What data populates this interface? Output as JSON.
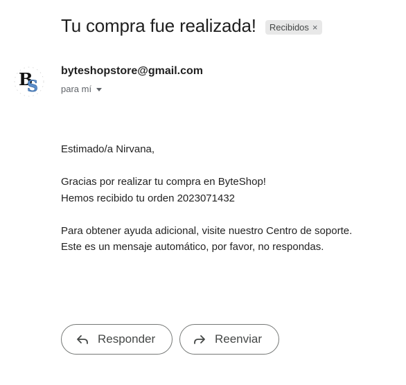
{
  "email": {
    "subject": "Tu compra fue realizada!",
    "label_chip": {
      "text": "Recibidos",
      "remove_glyph": "×"
    },
    "sender": {
      "email": "byteshopstore@gmail.com",
      "recipient_text": "para mí",
      "avatar_icon": "byteshop-logo-icon"
    },
    "body": {
      "greeting": "Estimado/a Nirvana,",
      "line1": "Gracias por realizar tu compra en ByteShop!",
      "line2": "Hemos recibido tu orden 2023071432",
      "line3": "Para obtener ayuda adicional, visite nuestro Centro de soporte.",
      "line4": "Este es un mensaje automático, por favor, no respondas."
    },
    "actions": {
      "reply_label": "Responder",
      "reply_icon": "reply-icon",
      "forward_label": "Reenviar",
      "forward_icon": "forward-icon"
    }
  }
}
